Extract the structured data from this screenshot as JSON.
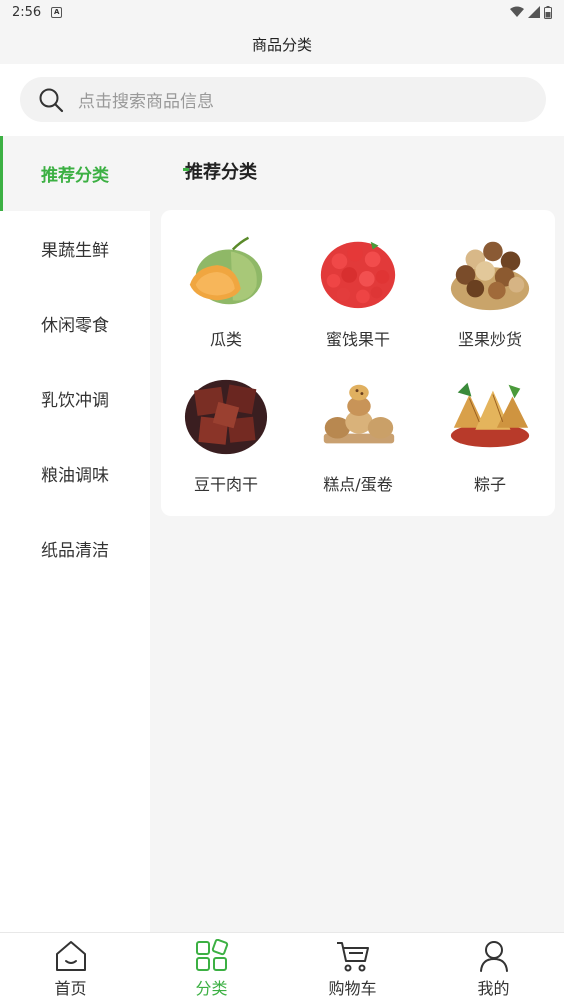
{
  "status_bar": {
    "time": "2:56",
    "notification_letter": "A"
  },
  "header": {
    "title": "商品分类"
  },
  "search": {
    "placeholder": "点击搜索商品信息"
  },
  "sidebar": {
    "items": [
      {
        "label": "推荐分类",
        "active": true
      },
      {
        "label": "果蔬生鲜",
        "active": false
      },
      {
        "label": "休闲零食",
        "active": false
      },
      {
        "label": "乳饮冲调",
        "active": false
      },
      {
        "label": "粮油调味",
        "active": false
      },
      {
        "label": "纸品清洁",
        "active": false
      }
    ]
  },
  "main": {
    "section_title": "推荐分类",
    "categories": [
      {
        "label": "瓜类",
        "icon": "melon-icon"
      },
      {
        "label": "蜜饯果干",
        "icon": "dried-strawberry-icon"
      },
      {
        "label": "坚果炒货",
        "icon": "nuts-icon"
      },
      {
        "label": "豆干肉干",
        "icon": "jerky-icon"
      },
      {
        "label": "糕点/蛋卷",
        "icon": "pastry-icon"
      },
      {
        "label": "粽子",
        "icon": "zongzi-icon"
      }
    ]
  },
  "tabbar": {
    "items": [
      {
        "label": "首页",
        "icon": "home-icon",
        "active": false
      },
      {
        "label": "分类",
        "icon": "category-icon",
        "active": true
      },
      {
        "label": "购物车",
        "icon": "cart-icon",
        "active": false
      },
      {
        "label": "我的",
        "icon": "profile-icon",
        "active": false
      }
    ]
  },
  "colors": {
    "accent": "#3cb043",
    "background": "#f5f5f5"
  }
}
